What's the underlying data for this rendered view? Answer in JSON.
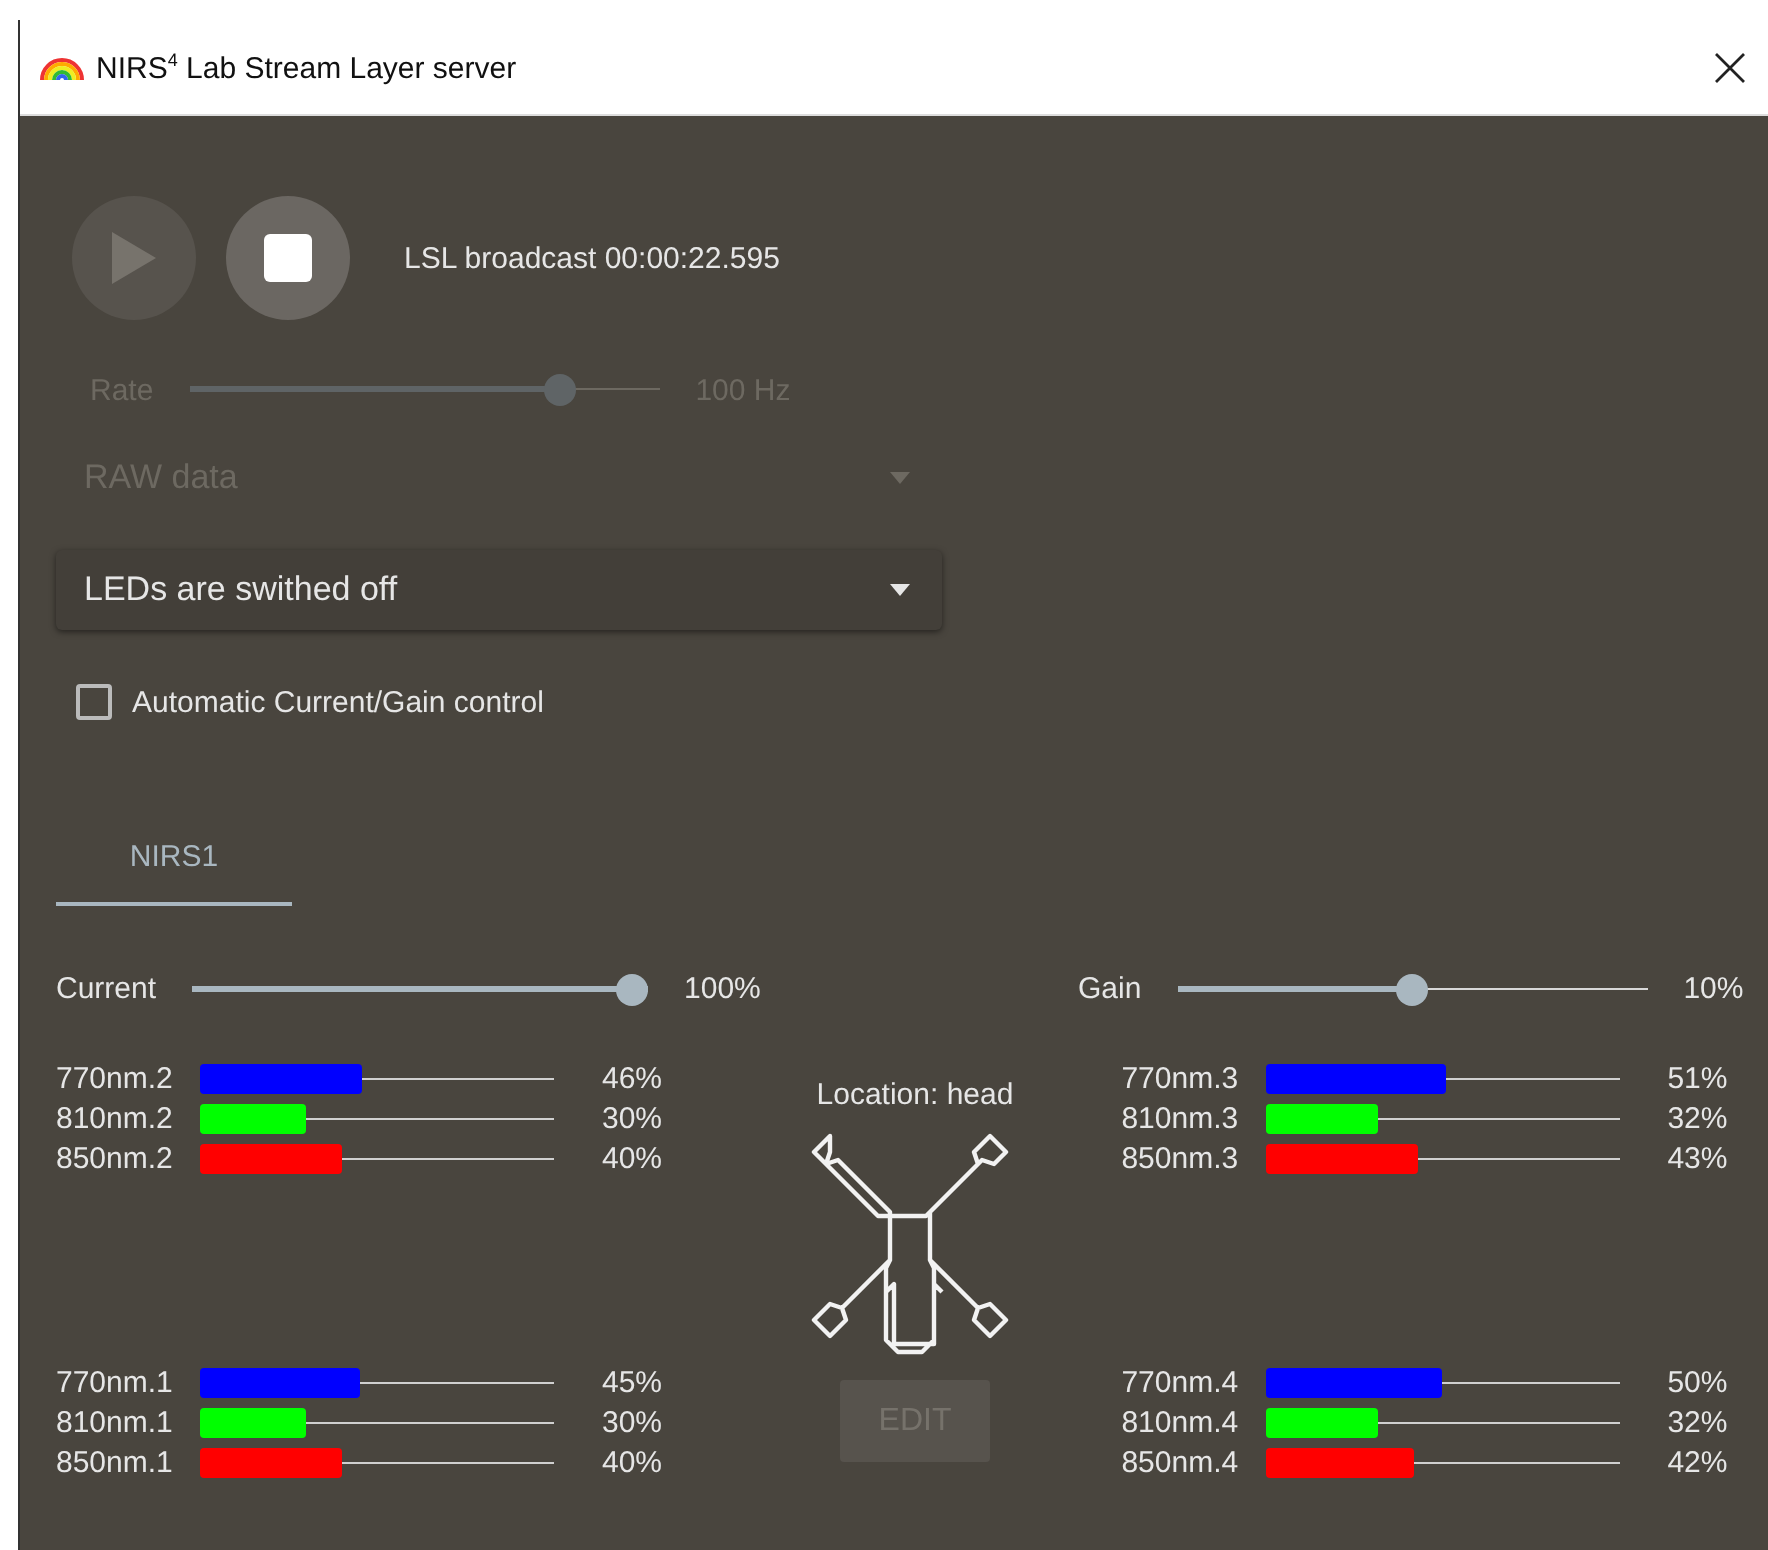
{
  "window": {
    "title": "NIRS$^{4}$ Lab Stream Layer server"
  },
  "transport": [
    {
      "kind": "play",
      "disabled": true
    },
    {
      "kind": "stop",
      "disabled": false
    }
  ],
  "status": "LSL broadcast 00:00:22.595",
  "rate": {
    "label": "Rate",
    "level": 0.81,
    "reading": "100 Hz",
    "disabled": true
  },
  "data_select": {
    "value": "RAW data",
    "disabled": true
  },
  "led_select": {
    "value": "LEDs are swithed off",
    "disabled": false
  },
  "auto_control": {
    "label": "Automatic Current/Gain control",
    "checked": false
  },
  "tabs": [
    {
      "label": "NIRS1",
      "selected": true
    }
  ],
  "current": {
    "label": "Current",
    "level": 1,
    "reading": "100%"
  },
  "gain": {
    "label": "Gain",
    "level": 0.5,
    "reading": "10%"
  },
  "location": "Location: head",
  "edit_button": {
    "label": "EDIT",
    "disabled": true
  },
  "channel_groups": [
    {
      "channels": [
        {
          "name": "770nm.2",
          "color": "#0000ff",
          "level": 0.46,
          "reading": "46%"
        },
        {
          "name": "810nm.2",
          "color": "#00ff00",
          "level": 0.3,
          "reading": "30%"
        },
        {
          "name": "850nm.2",
          "color": "#ff0000",
          "level": 0.4,
          "reading": "40%"
        }
      ]
    },
    {
      "channels": [
        {
          "name": "770nm.3",
          "color": "#0000ff",
          "level": 0.51,
          "reading": "51%"
        },
        {
          "name": "810nm.3",
          "color": "#00ff00",
          "level": 0.32,
          "reading": "32%"
        },
        {
          "name": "850nm.3",
          "color": "#ff0000",
          "level": 0.43,
          "reading": "43%"
        }
      ]
    },
    {
      "channels": [
        {
          "name": "770nm.1",
          "color": "#0000ff",
          "level": 0.45,
          "reading": "45%"
        },
        {
          "name": "810nm.1",
          "color": "#00ff00",
          "level": 0.3,
          "reading": "30%"
        },
        {
          "name": "850nm.1",
          "color": "#ff0000",
          "level": 0.4,
          "reading": "40%"
        }
      ]
    },
    {
      "channels": [
        {
          "name": "770nm.4",
          "color": "#0000ff",
          "level": 0.5,
          "reading": "50%"
        },
        {
          "name": "810nm.4",
          "color": "#00ff00",
          "level": 0.32,
          "reading": "32%"
        },
        {
          "name": "850nm.4",
          "color": "#ff0000",
          "level": 0.42,
          "reading": "42%"
        }
      ]
    }
  ]
}
